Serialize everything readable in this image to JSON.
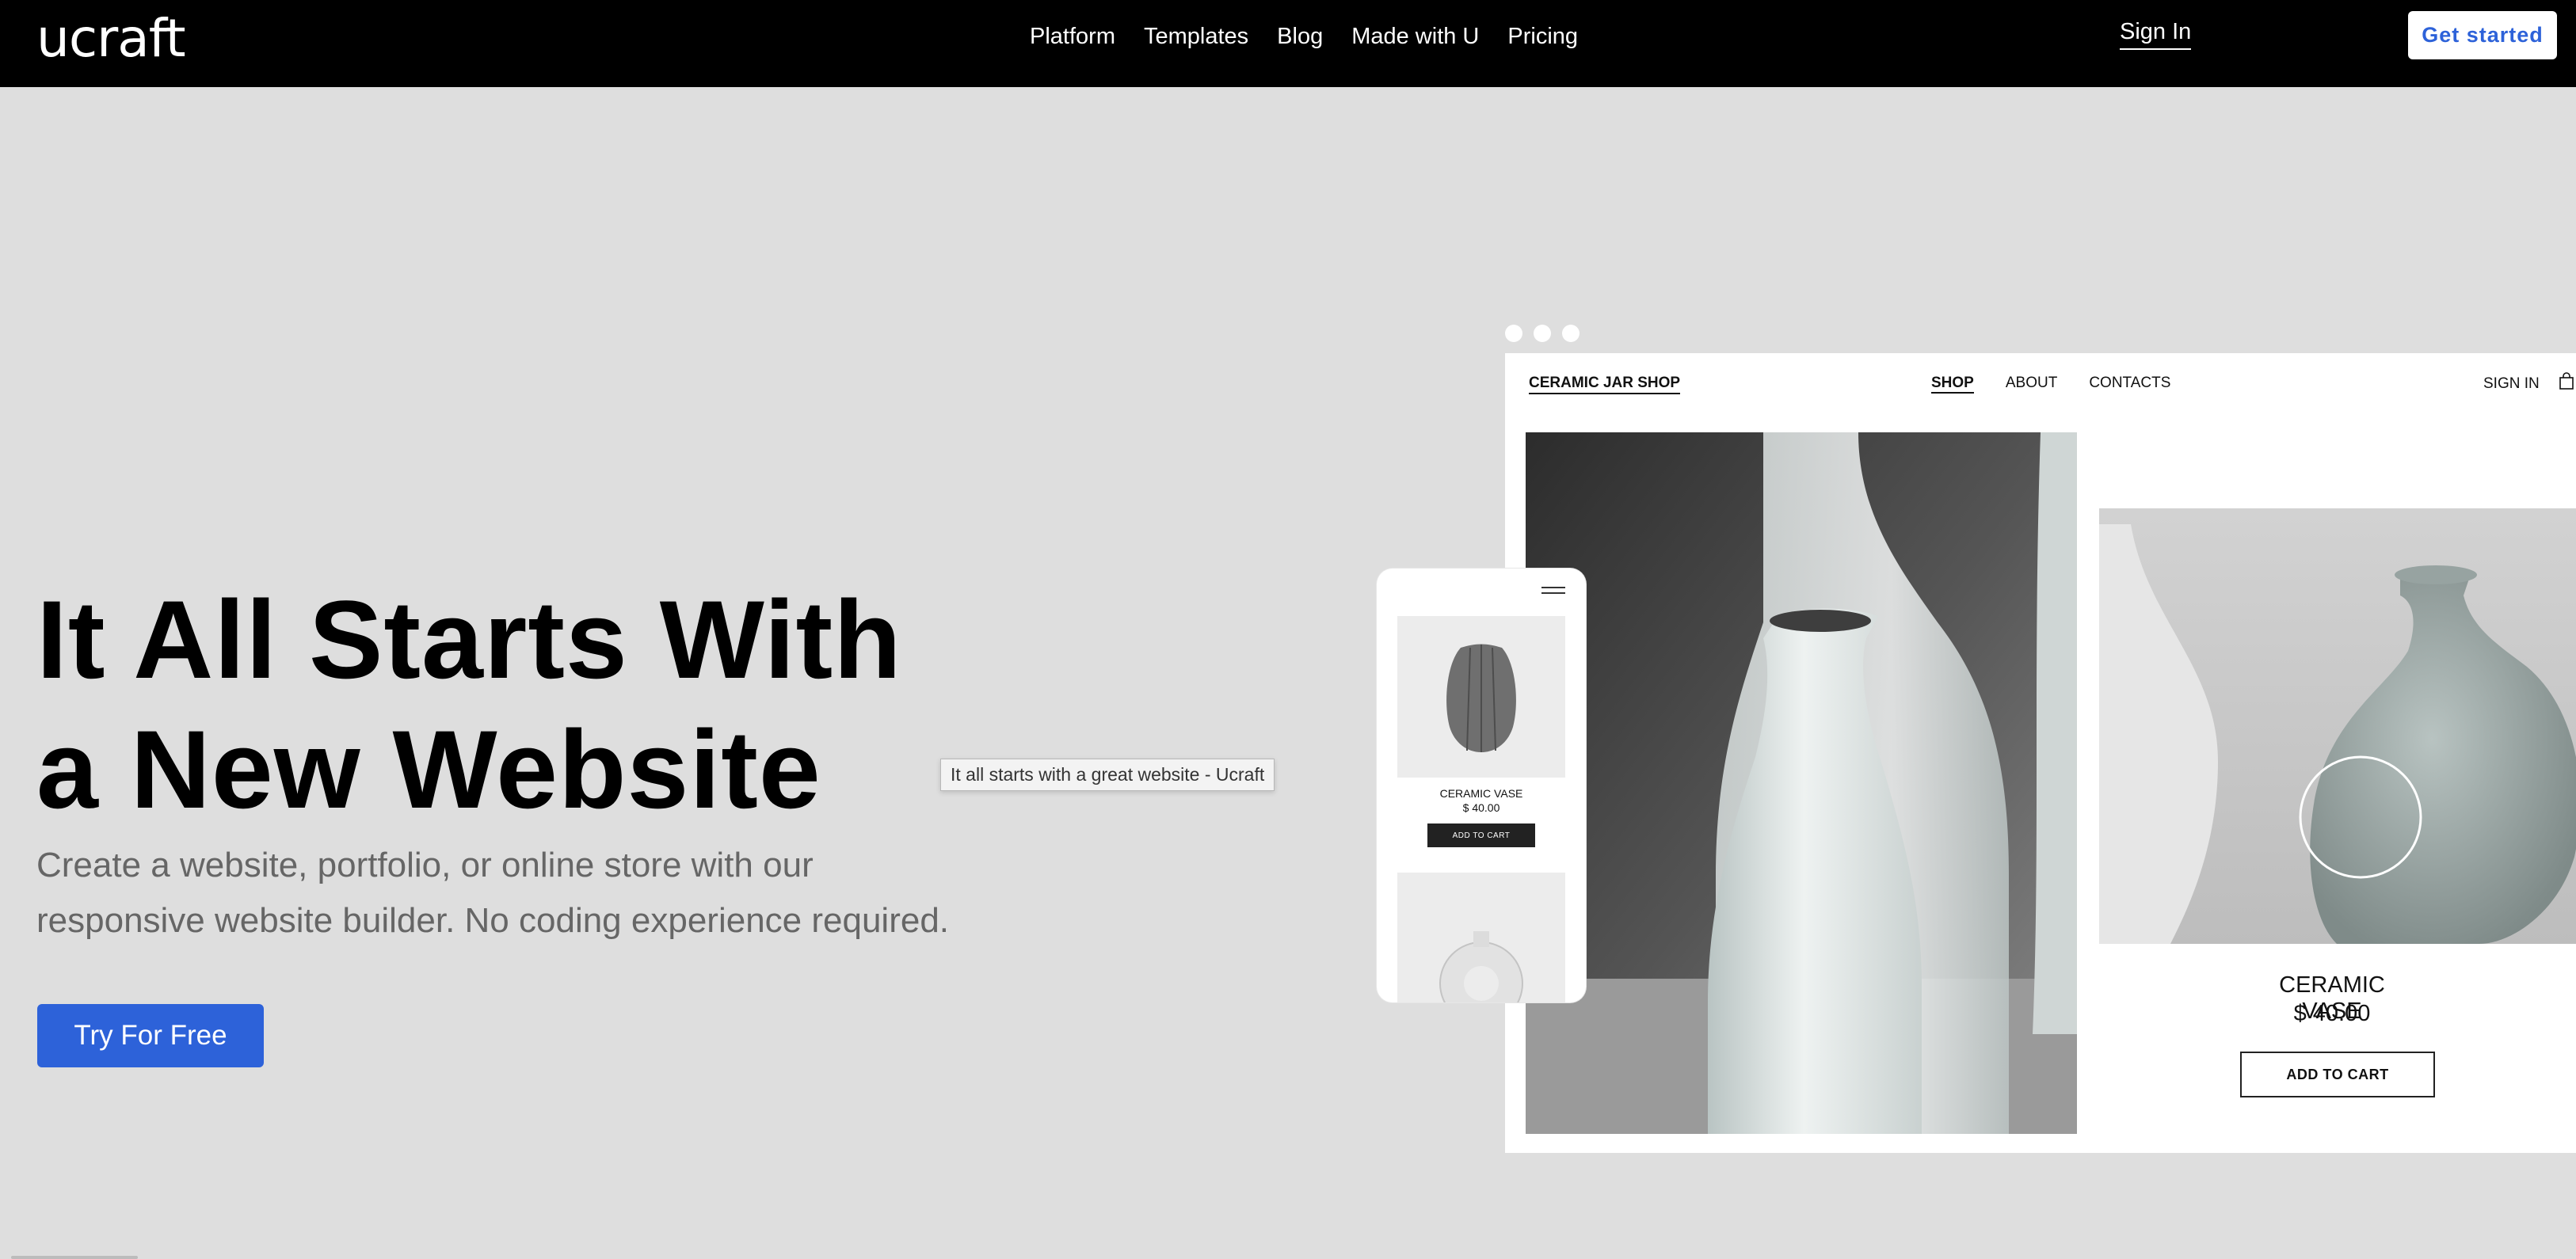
{
  "header": {
    "logo": "ucraft",
    "nav": [
      "Platform",
      "Templates",
      "Blog",
      "Made with U",
      "Pricing"
    ],
    "sign_in": "Sign In",
    "get_started": "Get started"
  },
  "hero": {
    "title_line1": "It All Starts With",
    "title_line2": "a New Website",
    "subtitle_line1": "Create a website, portfolio, or online store with our",
    "subtitle_line2": "responsive website builder. No coding experience required.",
    "cta": "Try For Free",
    "tooltip": "It all starts with a great website - Ucraft"
  },
  "mockup": {
    "brand": "CERAMIC JAR SHOP",
    "nav": [
      {
        "label": "SHOP",
        "active": true
      },
      {
        "label": "ABOUT",
        "active": false
      },
      {
        "label": "CONTACTS",
        "active": false
      }
    ],
    "sign_in": "SIGN IN",
    "product_name": "CERAMIC VASE",
    "product_price": "$ 40.00",
    "add_to_cart": "ADD TO CART",
    "phone": {
      "product_name": "CERAMIC VASE",
      "product_price": "$ 40.00",
      "add_to_cart": "ADD TO CART"
    }
  },
  "colors": {
    "header_bg": "#000000",
    "page_bg": "#dedede",
    "accent_blue": "#2d62d9"
  }
}
